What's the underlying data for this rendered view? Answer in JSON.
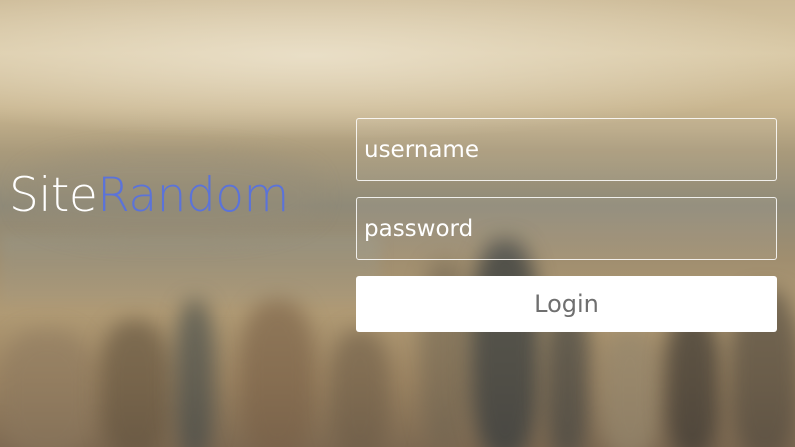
{
  "logo": {
    "part1": "Site",
    "part2": "Random",
    "accent_color": "#5b73d9"
  },
  "login_form": {
    "username_placeholder": "username",
    "password_placeholder": "password",
    "username_value": "",
    "password_value": "",
    "login_label": "Login"
  }
}
